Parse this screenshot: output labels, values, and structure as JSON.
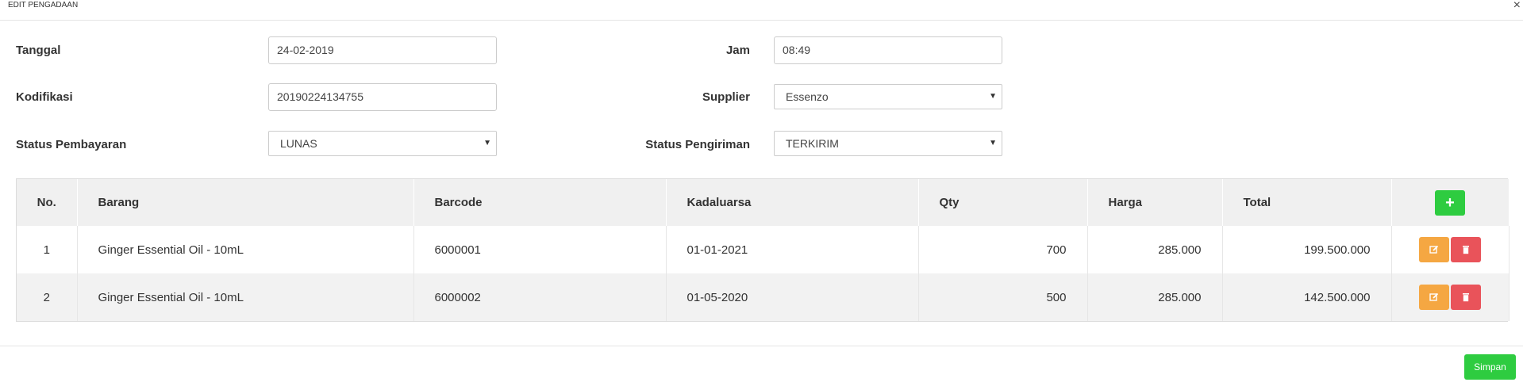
{
  "header": {
    "title": "EDIT PENGADAAN",
    "close_glyph": "×"
  },
  "form": {
    "tanggal": {
      "label": "Tanggal",
      "value": "24-02-2019"
    },
    "jam": {
      "label": "Jam",
      "value": "08:49"
    },
    "kodifikasi": {
      "label": "Kodifikasi",
      "value": "20190224134755"
    },
    "supplier": {
      "label": "Supplier",
      "value": "Essenzo"
    },
    "status_pembayaran": {
      "label": "Status Pembayaran",
      "value": "LUNAS"
    },
    "status_pengiriman": {
      "label": "Status Pengiriman",
      "value": "TERKIRIM"
    }
  },
  "table": {
    "columns": [
      "No.",
      "Barang",
      "Barcode",
      "Kadaluarsa",
      "Qty",
      "Harga",
      "Total"
    ],
    "add_glyph": "+",
    "rows": [
      {
        "no": "1",
        "barang": "Ginger Essential Oil - 10mL",
        "barcode": "6000001",
        "kadaluarsa": "01-01-2021",
        "qty": "700",
        "harga": "285.000",
        "total": "199.500.000"
      },
      {
        "no": "2",
        "barang": "Ginger Essential Oil - 10mL",
        "barcode": "6000002",
        "kadaluarsa": "01-05-2020",
        "qty": "500",
        "harga": "285.000",
        "total": "142.500.000"
      }
    ]
  },
  "footer": {
    "save_label": "Simpan"
  },
  "colors": {
    "green": "#2ecc40",
    "orange": "#f5a742",
    "red": "#e9535a"
  },
  "icons": {
    "add": "plus-icon",
    "edit": "edit-icon",
    "delete": "trash-icon",
    "close": "close-icon",
    "dropdown": "caret-down-icon"
  }
}
